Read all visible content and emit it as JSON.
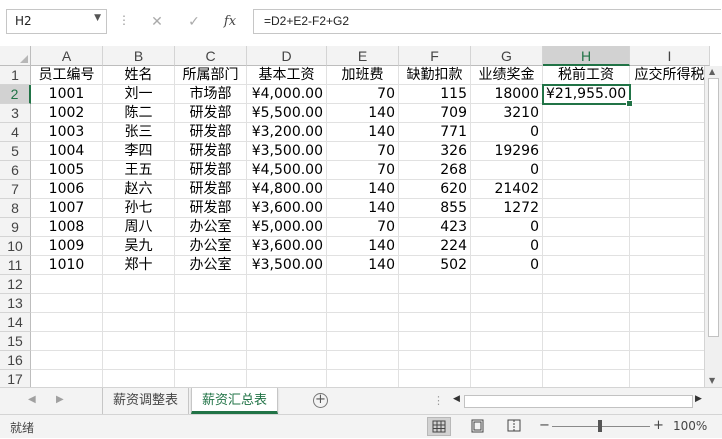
{
  "formula_bar": {
    "name_box": "H2",
    "cancel_icon": "✕",
    "enter_icon": "✓",
    "fx_label": "fx",
    "formula": "=D2+E2-F2+G2"
  },
  "columns": [
    "A",
    "B",
    "C",
    "D",
    "E",
    "F",
    "G",
    "H",
    "I"
  ],
  "selected_column": "H",
  "selected_row": "2",
  "row_numbers": [
    "1",
    "2",
    "3",
    "4",
    "5",
    "6",
    "7",
    "8",
    "9",
    "10",
    "11",
    "12",
    "13",
    "14",
    "15",
    "16",
    "17"
  ],
  "headers": [
    "员工编号",
    "姓名",
    "所属部门",
    "基本工资",
    "加班费",
    "缺勤扣款",
    "业绩奖金",
    "税前工资",
    "应交所得税"
  ],
  "rows": [
    [
      "1001",
      "刘一",
      "市场部",
      "¥4,000.00",
      "70",
      "115",
      "18000",
      "¥21,955.00",
      ""
    ],
    [
      "1002",
      "陈二",
      "研发部",
      "¥5,500.00",
      "140",
      "709",
      "3210",
      "",
      ""
    ],
    [
      "1003",
      "张三",
      "研发部",
      "¥3,200.00",
      "140",
      "771",
      "0",
      "",
      ""
    ],
    [
      "1004",
      "李四",
      "研发部",
      "¥3,500.00",
      "70",
      "326",
      "19296",
      "",
      ""
    ],
    [
      "1005",
      "王五",
      "研发部",
      "¥4,500.00",
      "70",
      "268",
      "0",
      "",
      ""
    ],
    [
      "1006",
      "赵六",
      "研发部",
      "¥4,800.00",
      "140",
      "620",
      "21402",
      "",
      ""
    ],
    [
      "1007",
      "孙七",
      "研发部",
      "¥3,600.00",
      "140",
      "855",
      "1272",
      "",
      ""
    ],
    [
      "1008",
      "周八",
      "办公室",
      "¥5,000.00",
      "70",
      "423",
      "0",
      "",
      ""
    ],
    [
      "1009",
      "吴九",
      "办公室",
      "¥3,600.00",
      "140",
      "224",
      "0",
      "",
      ""
    ],
    [
      "1010",
      "郑十",
      "办公室",
      "¥3,500.00",
      "140",
      "502",
      "0",
      "",
      ""
    ]
  ],
  "sheet_tabs": [
    {
      "label": "薪资调整表",
      "active": false
    },
    {
      "label": "薪资汇总表",
      "active": true
    }
  ],
  "status_bar": {
    "ready_text": "就绪",
    "zoom": "100%"
  },
  "colors": {
    "accent": "#217346",
    "header_bg": "#f3f3f3",
    "gridline": "#e1e1e1"
  }
}
